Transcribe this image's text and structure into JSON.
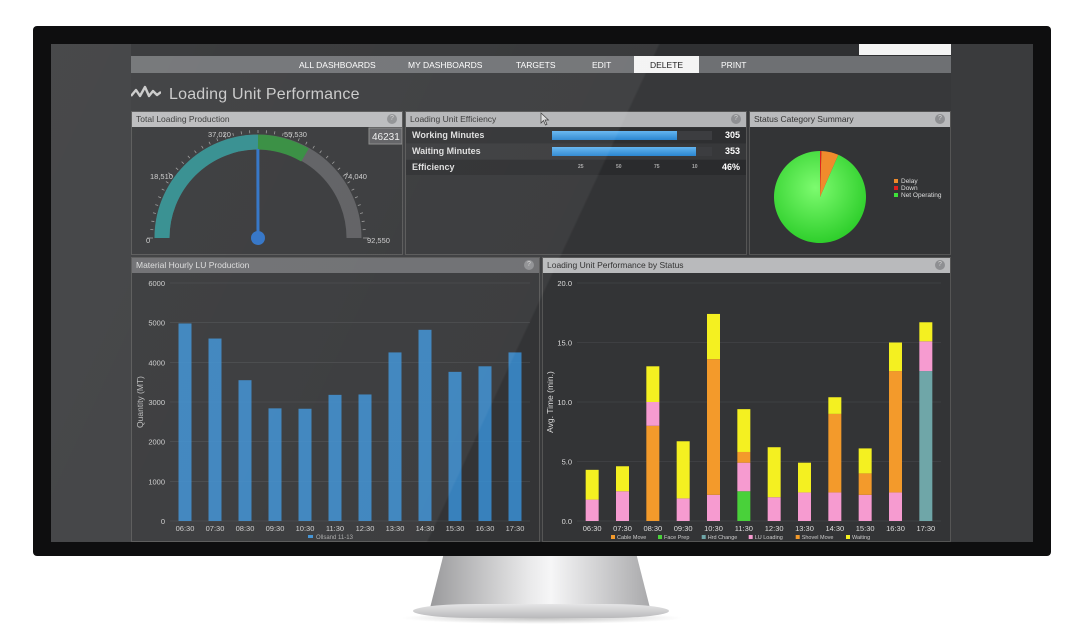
{
  "nav": {
    "items": [
      "ALL DASHBOARDS",
      "MY DASHBOARDS",
      "TARGETS",
      "EDIT",
      "DELETE",
      "PRINT"
    ],
    "active": "DELETE"
  },
  "page": {
    "title": "Loading Unit Performance"
  },
  "panels": {
    "gauge": {
      "title": "Total Loading Production",
      "value": "46231",
      "ticks": [
        "0",
        "18,510",
        "37,020",
        "55,530",
        "74,040",
        "92,550"
      ],
      "min": 0,
      "max": 92550,
      "reading": 46231,
      "colors": {
        "track": "#5a5b5e",
        "teal": "#2e8b8c",
        "green": "#2f8a3a",
        "needle": "#2b6fc4"
      }
    },
    "efficiency": {
      "title": "Loading Unit Efficiency",
      "rows": [
        {
          "label": "Working Minutes",
          "value": "305",
          "fraction": 0.78
        },
        {
          "label": "Waiting Minutes",
          "value": "353",
          "fraction": 0.9
        },
        {
          "label": "Efficiency",
          "value": "46%"
        }
      ],
      "ticks": [
        "25",
        "50",
        "75",
        "10"
      ]
    },
    "status": {
      "title": "Status Category Summary",
      "legend": [
        {
          "label": "Delay",
          "color": "#f08b2c"
        },
        {
          "label": "Down",
          "color": "#e02020"
        },
        {
          "label": "Net Operating",
          "color": "#3ee23a"
        }
      ],
      "slices": [
        {
          "label": "Net Operating",
          "value": 93.5,
          "color": "#3ee23a"
        },
        {
          "label": "Down",
          "value": 0.5,
          "color": "#e02020"
        },
        {
          "label": "Delay",
          "value": 6.0,
          "color": "#f08b2c"
        }
      ]
    },
    "hourly": {
      "title": "Material Hourly LU Production",
      "ylabel": "Quantity (MT)",
      "legend": "Ollsand 11-13"
    },
    "perf": {
      "title": "Loading Unit Performance by Status",
      "ylabel": "Avg. Time (min.)",
      "legend": [
        {
          "label": "Cable Move",
          "color": "#f39a2b"
        },
        {
          "label": "Face Prep",
          "color": "#49d13a"
        },
        {
          "label": "Hrd Change",
          "color": "#6fa6a8"
        },
        {
          "label": "LU Loading",
          "color": "#f69bd0"
        },
        {
          "label": "Shovel Move",
          "color": "#f39a2b"
        },
        {
          "label": "Waiting",
          "color": "#f4f021"
        }
      ]
    }
  },
  "chart_data": [
    {
      "type": "bar",
      "title": "Material Hourly LU Production",
      "ylabel": "Quantity (MT)",
      "xlabel": "",
      "categories": [
        "06:30",
        "07:30",
        "08:30",
        "09:30",
        "10:30",
        "11:30",
        "12:30",
        "13:30",
        "14:30",
        "15:30",
        "16:30",
        "17:30"
      ],
      "series": [
        {
          "name": "Ollsand 11-13",
          "values": [
            4980,
            4600,
            3550,
            2840,
            2830,
            3180,
            3190,
            4250,
            4820,
            3760,
            3900,
            4250
          ]
        }
      ],
      "yticks": [
        "0",
        "1000",
        "2000",
        "3000",
        "4000",
        "5000",
        "6000"
      ],
      "ylim": [
        0,
        6000
      ],
      "color": "#3a8fd4",
      "grid": true,
      "legend_position": "bottom"
    },
    {
      "type": "bar",
      "stacked": true,
      "title": "Loading Unit Performance by Status",
      "ylabel": "Avg. Time (min.)",
      "xlabel": "",
      "categories": [
        "06:30",
        "07:30",
        "08:30",
        "09:30",
        "10:30",
        "11:30",
        "12:30",
        "13:30",
        "14:30",
        "15:30",
        "16:30",
        "17:30"
      ],
      "series": [
        {
          "name": "Hrd Change",
          "color": "#6fa6a8",
          "values": [
            0,
            0,
            0,
            0,
            0,
            0,
            0,
            0,
            0,
            0,
            0,
            12.6
          ]
        },
        {
          "name": "Face Prep",
          "color": "#49d13a",
          "values": [
            0,
            0,
            0,
            0,
            0,
            2.5,
            0,
            0,
            0,
            0,
            0,
            0
          ]
        },
        {
          "name": "LU Loading",
          "color": "#f69bd0",
          "values": [
            1.8,
            2.5,
            0,
            1.9,
            2.2,
            2.4,
            2.0,
            2.4,
            2.4,
            2.2,
            2.4,
            2.5
          ]
        },
        {
          "name": "Cable Move",
          "color": "#f39a2b",
          "values": [
            0,
            0,
            8.0,
            0,
            11.4,
            0.9,
            0,
            0,
            6.6,
            0,
            10.2,
            0
          ]
        },
        {
          "name": "LU Loading",
          "color": "#f69bd0",
          "values": [
            0,
            0,
            2.0,
            0,
            0,
            0,
            0,
            0,
            0,
            0,
            0,
            0
          ]
        },
        {
          "name": "Shovel Move",
          "color": "#f39a2b",
          "values": [
            0,
            0,
            0,
            0,
            0,
            0,
            0,
            0,
            0,
            1.8,
            0,
            0
          ]
        },
        {
          "name": "Waiting",
          "color": "#f4f021",
          "values": [
            2.5,
            2.1,
            3.0,
            4.8,
            3.8,
            3.6,
            4.2,
            2.5,
            1.4,
            2.1,
            2.4,
            1.6
          ]
        }
      ],
      "yticks": [
        "0.0",
        "5.0",
        "10.0",
        "15.0",
        "20.0"
      ],
      "ylim": [
        0,
        20
      ],
      "grid": true,
      "legend_position": "bottom"
    }
  ]
}
